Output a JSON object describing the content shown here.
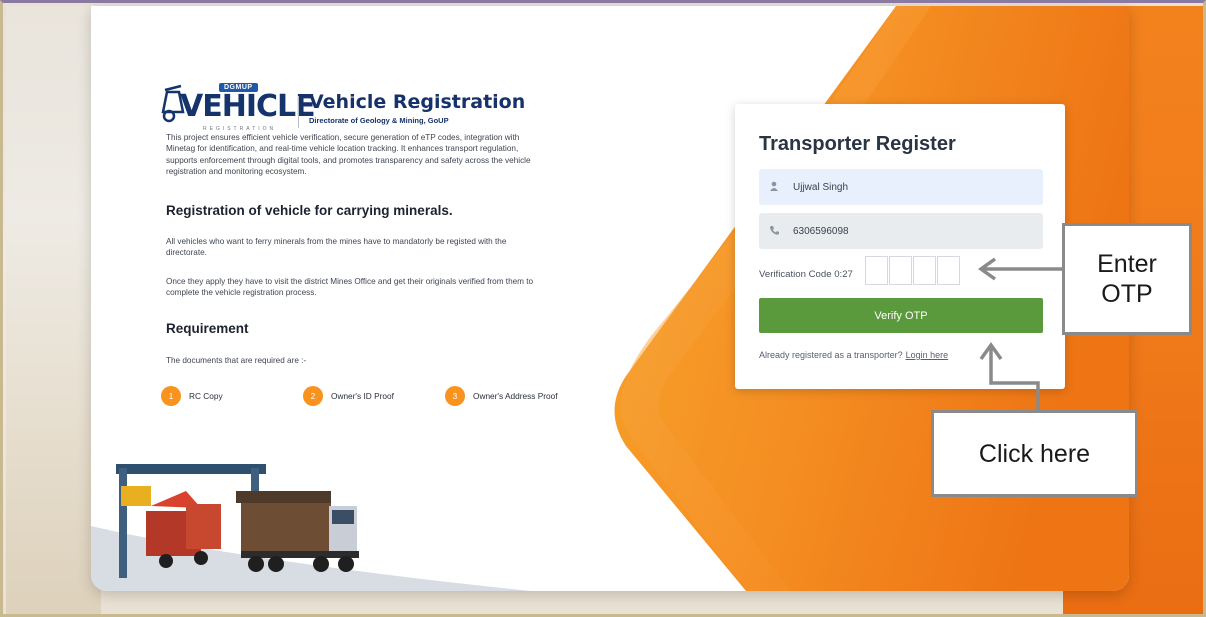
{
  "brand": {
    "logo_badge": "DGMUP",
    "logo_word": "VEHICLE",
    "logo_sub": "REGISTRATION",
    "title": "Vehicle Registration",
    "subtitle": "Directorate of Geology & Mining, GoUP"
  },
  "intro": {
    "line1": "This project ensures efficient vehicle verification, secure generation of eTP codes, integration with",
    "line2": "Minetag for identification, and real-time vehicle location tracking. It enhances transport regulation,",
    "line3": "supports enforcement through digital tools, and promotes transparency and safety across the vehicle",
    "line4": "registration and monitoring ecosystem."
  },
  "registration": {
    "heading": "Registration of vehicle for carrying minerals.",
    "p1_line1": "All vehicles who want to ferry minerals from the mines have to mandatorly be registed with the",
    "p1_line2": "directorate.",
    "p2_line1": "Once they apply they have to visit the district Mines Office and get their originals verified from them to",
    "p2_line2": "complete the vehicle registration process."
  },
  "requirement": {
    "heading": "Requirement",
    "intro": "The documents that are required are :-",
    "items": [
      {
        "num": "1",
        "label": "RC Copy"
      },
      {
        "num": "2",
        "label": "Owner's ID Proof"
      },
      {
        "num": "3",
        "label": "Owner's Address Proof"
      }
    ]
  },
  "form": {
    "title": "Transporter Register",
    "name_value": "Ujjwal Singh",
    "phone_value": "6306596098",
    "otp_label": "Verification Code 0:27",
    "verify_label": "Verify OTP",
    "already_text": "Already registered as a transporter?",
    "login_link": "Login here",
    "user_icon": "user-icon",
    "phone_icon": "phone-icon"
  },
  "callouts": {
    "enter_otp_line1": "Enter",
    "enter_otp_line2": "OTP",
    "click_here": "Click here"
  },
  "colors": {
    "accent_orange": "#f7931e",
    "button_green": "#5a9a3c",
    "brand_navy": "#17326b"
  }
}
